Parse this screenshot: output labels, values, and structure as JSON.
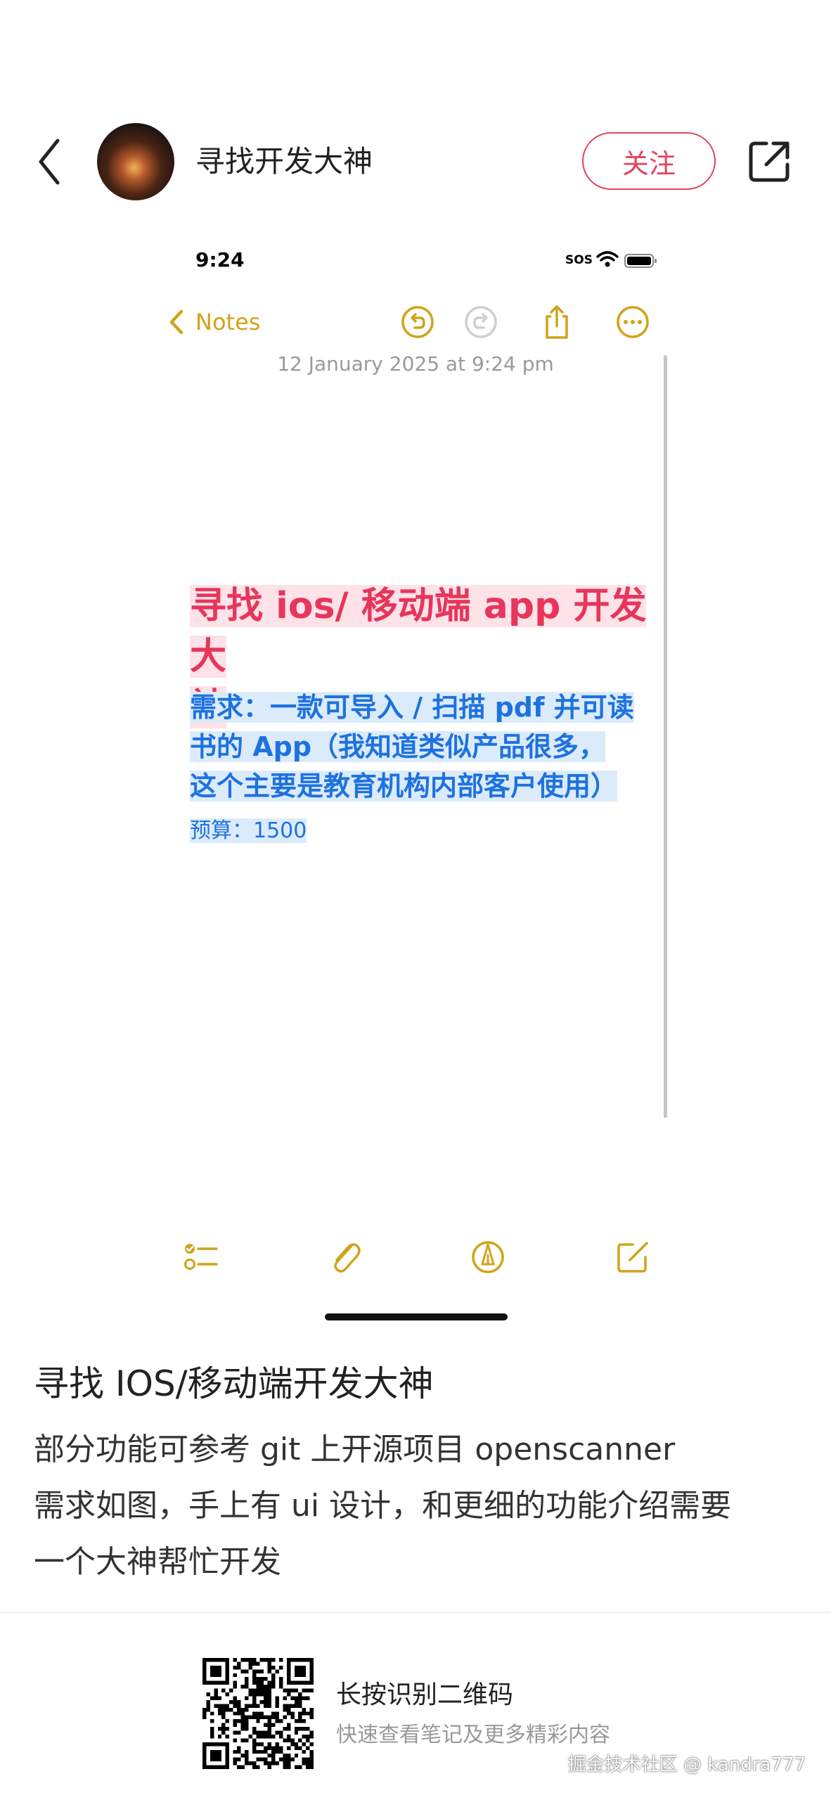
{
  "header": {
    "author_name": "寻找开发大神",
    "follow_label": "关注"
  },
  "status_bar": {
    "time": "9:24",
    "sos": "SOS"
  },
  "notes": {
    "back_label": "Notes",
    "date": "12 January 2025 at 9:24 pm",
    "title_lines": [
      "寻找 ios/ 移动端 app 开发大",
      "神"
    ],
    "requirement_lines": [
      "需求：一款可导入 / 扫描 pdf 并可读",
      "书的 App（我知道类似产品很多，",
      "这个主要是教育机构内部客户使用）"
    ],
    "budget": "预算：1500",
    "accent_color": "#d1a31a",
    "title_color": "#e8355b",
    "body_color": "#1d72e0"
  },
  "post": {
    "title": "寻找 IOS/移动端开发大神",
    "body_lines": [
      "部分功能可参考 git 上开源项目 openscanner",
      "需求如图，手上有 ui 设计，和更细的功能介绍需要",
      "一个大神帮忙开发"
    ]
  },
  "footer": {
    "qr_title": "长按识别二维码",
    "qr_subtitle": "快速查看笔记及更多精彩内容",
    "watermark": "掘金技术社区 @ kandra777"
  }
}
